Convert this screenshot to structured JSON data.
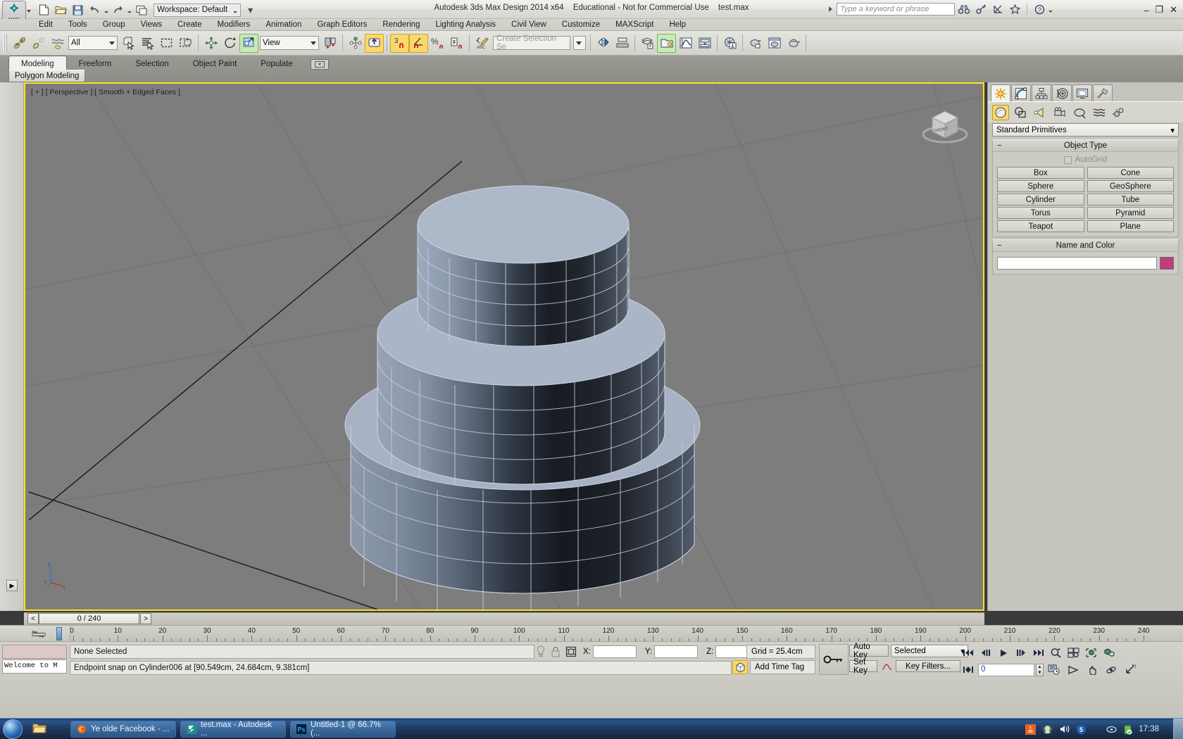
{
  "titlebar": {
    "workspace_label": "Workspace: Default",
    "app_name": "Autodesk 3ds Max Design 2014 x64",
    "license": "Educational - Not for Commercial Use",
    "filename": "test.max",
    "search_placeholder": "Type a keyword or phrase",
    "quick_access": [
      "new-file-icon",
      "open-file-icon",
      "save-file-icon",
      "undo-icon",
      "redo-icon",
      "project-folder-icon"
    ],
    "help_icons": [
      "binoculars-icon",
      "key-icon",
      "satellite-icon",
      "star-icon",
      "help-icon"
    ],
    "window_controls": [
      "minimize",
      "restore",
      "close"
    ]
  },
  "menu": {
    "items": [
      "Edit",
      "Tools",
      "Group",
      "Views",
      "Create",
      "Modifiers",
      "Animation",
      "Graph Editors",
      "Rendering",
      "Lighting Analysis",
      "Civil View",
      "Customize",
      "MAXScript",
      "Help"
    ]
  },
  "toolbar": {
    "selection_filter": "All",
    "reference_coord": "View",
    "named_selection_placeholder": "Create Selection Se",
    "snap_toggle_label": "3",
    "percent_label": "%",
    "icons": [
      "select-link-icon",
      "unlink-icon",
      "bind-space-warp-icon",
      "select-object-icon",
      "select-by-name-icon",
      "rect-selection-region-icon",
      "window-crossing-icon",
      "select-and-move-icon",
      "select-and-rotate-icon",
      "select-and-scale-icon",
      "use-pivot-center-icon",
      "select-and-manipulate-icon",
      "snaps-toggle-icon",
      "angle-snap-icon",
      "percent-snap-icon",
      "spinner-snap-icon",
      "edit-named-selection-icon",
      "mirror-icon",
      "align-icon",
      "layer-manager-icon",
      "scene-explorer-icon",
      "curve-editor-icon",
      "schematic-view-icon",
      "material-editor-icon",
      "render-setup-icon",
      "rendered-frame-icon",
      "render-production-icon"
    ]
  },
  "ribbon": {
    "tabs": [
      "Modeling",
      "Freeform",
      "Selection",
      "Object Paint",
      "Populate"
    ],
    "active_tab": "Modeling",
    "panel_label": "Polygon Modeling"
  },
  "viewport": {
    "label": "[ + ] [ Perspective ] [ Smooth + Edged Faces ]",
    "view_cube_label": "FRONT",
    "axis_labels": [
      "z",
      "y",
      "x"
    ],
    "background": "#7d7d7d",
    "border_color": "#ffe11a"
  },
  "command_panel": {
    "tabs": [
      "create-tab",
      "modify-tab",
      "hierarchy-tab",
      "motion-tab",
      "display-tab",
      "utilities-tab"
    ],
    "active_tab": "create-tab",
    "category_buttons": [
      "geometry-icon",
      "shapes-icon",
      "lights-icon",
      "cameras-icon",
      "helpers-icon",
      "space-warps-icon",
      "systems-icon"
    ],
    "active_category": "geometry-icon",
    "subcategory": "Standard Primitives",
    "object_type": {
      "title": "Object Type",
      "autogrid_label": "AutoGrid",
      "autogrid_checked": false,
      "buttons": [
        "Box",
        "Cone",
        "Sphere",
        "GeoSphere",
        "Cylinder",
        "Tube",
        "Torus",
        "Pyramid",
        "Teapot",
        "Plane"
      ]
    },
    "name_and_color": {
      "title": "Name and Color",
      "name_value": "",
      "color": "#c23d7c"
    }
  },
  "timeline": {
    "current_frame_label": "0 / 240",
    "prev_arrow": "<",
    "next_arrow": ">",
    "ruler_ticks": [
      0,
      10,
      20,
      30,
      40,
      50,
      60,
      70,
      80,
      90,
      100,
      110,
      120,
      130,
      140,
      150,
      160,
      170,
      180,
      190,
      200,
      210,
      220,
      230,
      240
    ]
  },
  "status": {
    "mini_listener_value": "Welcome to M",
    "selection_status": "None Selected",
    "prompt_line": "Endpoint snap on Cylinder006 at [90.549cm, 24.684cm, 9.381cm]",
    "x_label": "X:",
    "y_label": "Y:",
    "z_label": "Z:",
    "x_value": "",
    "y_value": "",
    "z_value": "",
    "grid_label": "Grid = 25.4cm",
    "add_time_tag": "Add Time Tag",
    "auto_key": "Auto Key",
    "set_key": "Set Key",
    "key_mode": "Selected",
    "key_filters": "Key Filters...",
    "frame_field_value": "0",
    "icons": [
      "isolate-selection-icon",
      "lock-selection-icon",
      "absolute-relative-icon",
      "adaptive-degradation-icon",
      "key-mode-toggle-icon"
    ],
    "nav_icons": [
      "zoom-icon",
      "zoom-all-icon",
      "zoom-extents-icon",
      "zoom-region-icon",
      "maximize-viewport-icon",
      "field-of-view-icon",
      "pan-icon",
      "orbit-icon",
      "time-config-icon"
    ],
    "playback_icons": [
      "go-to-start-icon",
      "previous-frame-icon",
      "play-icon",
      "next-frame-icon",
      "go-to-end-icon",
      "key-mode-icon"
    ]
  },
  "taskbar": {
    "start_label": "start-orb-icon",
    "quicklaunch": [
      "explorer-icon"
    ],
    "items": [
      {
        "icon": "firefox-icon",
        "label": "Ye olde Facebook - ..."
      },
      {
        "icon": "max-icon",
        "label": "test.max - Autodesk ..."
      },
      {
        "icon": "photoshop-icon",
        "label": "Untitled-1 @ 66.7% (..."
      }
    ],
    "tray_icons": [
      "java-icon",
      "headset-icon",
      "volume-icon",
      "security-icon",
      "disc-icon",
      "battery-icon"
    ],
    "clock": "17:38"
  }
}
